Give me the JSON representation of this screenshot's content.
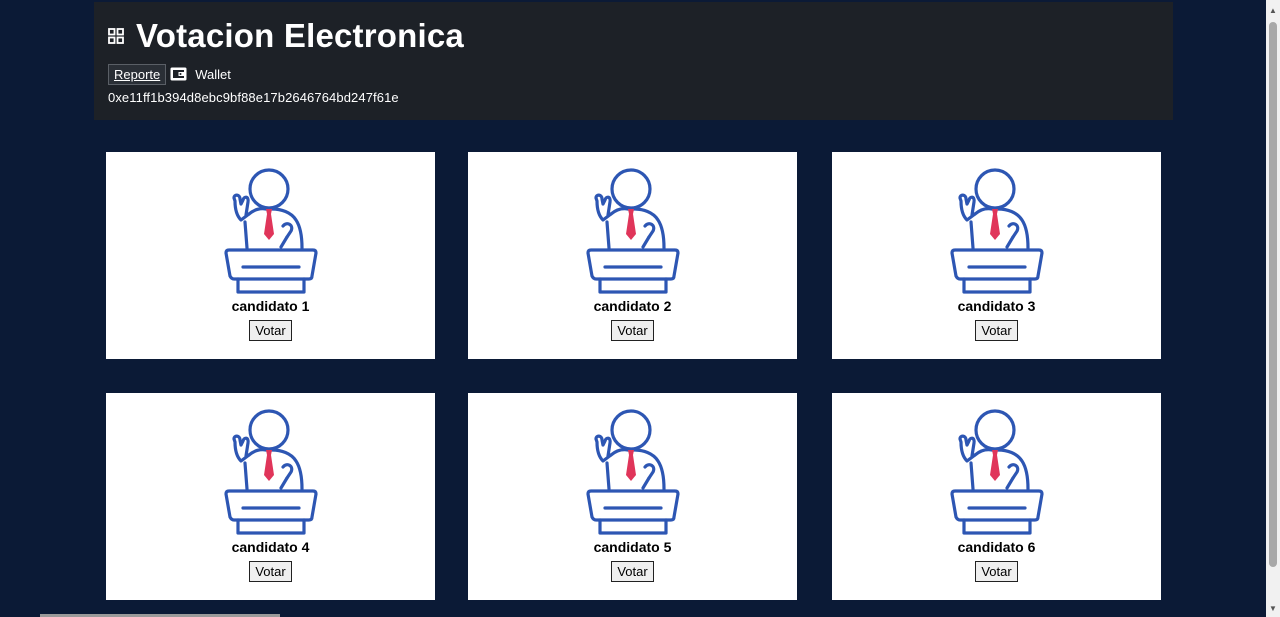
{
  "header": {
    "title": "Votacion Electronica",
    "report_link": "Reporte",
    "wallet_label": "Wallet",
    "address": "0xe11ff1b394d8ebc9bf88e17b2646764bd247f61e"
  },
  "candidates": [
    {
      "name": "candidato 1",
      "button": "Votar"
    },
    {
      "name": "candidato 2",
      "button": "Votar"
    },
    {
      "name": "candidato 3",
      "button": "Votar"
    },
    {
      "name": "candidato 4",
      "button": "Votar"
    },
    {
      "name": "candidato 5",
      "button": "Votar"
    },
    {
      "name": "candidato 6",
      "button": "Votar"
    }
  ],
  "icons": {
    "app": "grid-icon",
    "wallet": "wallet-icon",
    "candidate": "speaker-podium-icon"
  },
  "colors": {
    "page_bg": "#0b1a36",
    "header_bg": "#1d2127",
    "figure_outline": "#2d56b3",
    "tie": "#e0355a"
  }
}
